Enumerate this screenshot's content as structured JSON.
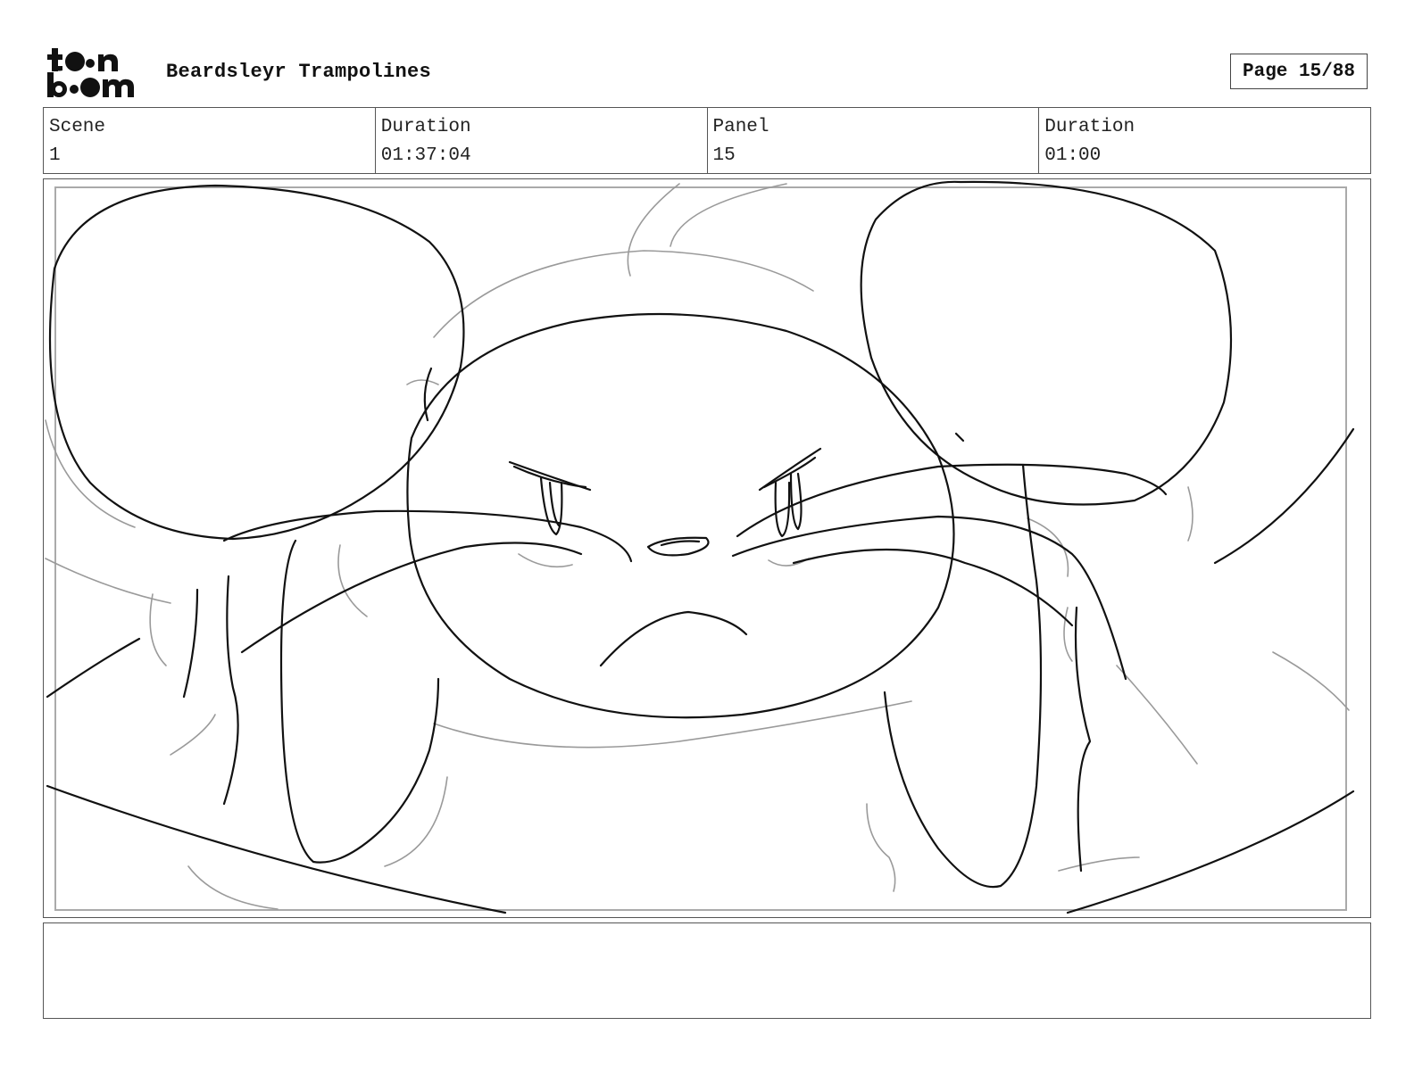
{
  "header": {
    "logo_top": "t●●n",
    "logo_bottom": "b●●m",
    "project_title": "Beardsleyr Trampolines",
    "page_indicator": "Page 15/88"
  },
  "info_bar": {
    "scene_label": "Scene",
    "scene_value": "1",
    "scene_duration_label": "Duration",
    "scene_duration_value": "01:37:04",
    "panel_label": "Panel",
    "panel_value": "15",
    "panel_duration_label": "Duration",
    "panel_duration_value": "01:00"
  },
  "panel": {
    "sketch_icon": "mouse-character-sketch-icon",
    "stroke_color": "#111111",
    "light_stroke_color": "#9a9a9a"
  },
  "notes": {
    "text": ""
  }
}
